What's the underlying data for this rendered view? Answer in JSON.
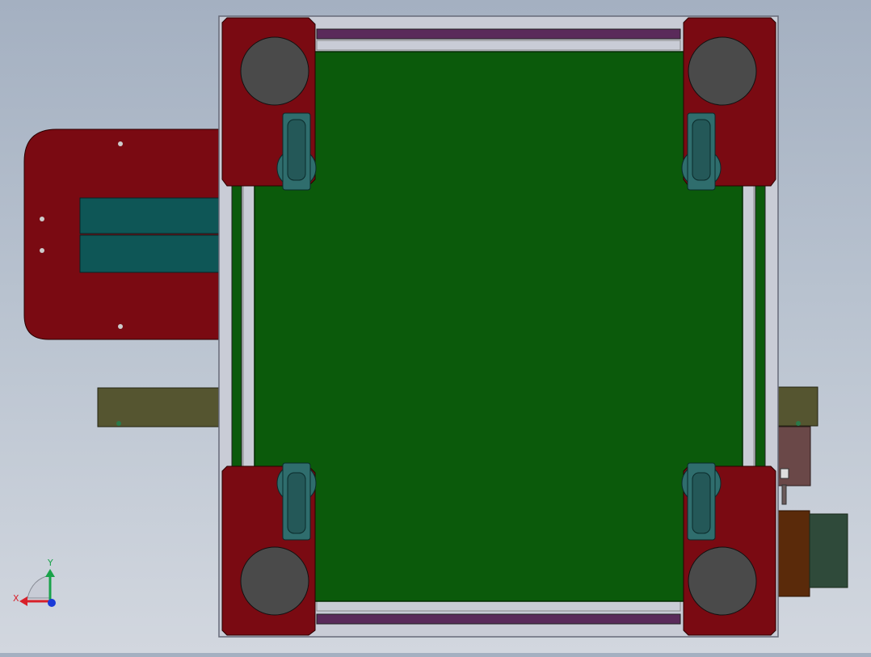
{
  "app": {
    "view": "top view"
  },
  "triad": {
    "x_label": "X",
    "y_label": "Y",
    "colors": {
      "x": "#d8202a",
      "y": "#1aa24a",
      "z": "#1a3ad8"
    }
  },
  "model": {
    "description_colors": {
      "frame": "#c9ccd6",
      "deck": "#0b5a0b",
      "corner_plate": "#7a0a12",
      "wheel": "#4a4a4a",
      "caster": "#2f6d6d",
      "side_plate": "#7a0a12",
      "slot_panel": "#0e5656",
      "bar": "#555530",
      "rail": "#5a2a5a"
    }
  }
}
